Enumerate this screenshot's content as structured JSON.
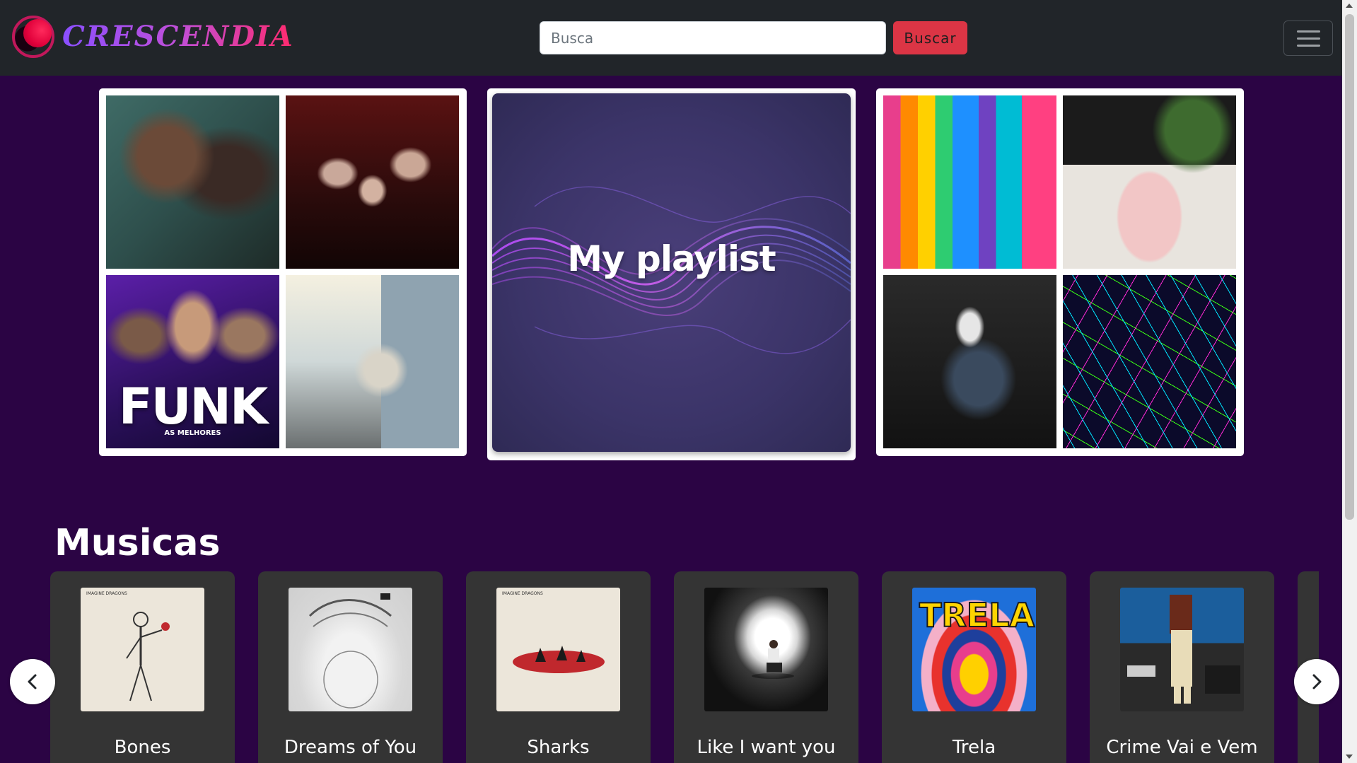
{
  "header": {
    "brand": "CRESCENDIA",
    "search": {
      "placeholder": "Busca",
      "value": ""
    },
    "search_button": "Buscar"
  },
  "featured": {
    "left_collage": {
      "tiles": [
        {
          "icon": "artist-photo-duo"
        },
        {
          "icon": "band-photo"
        },
        {
          "icon": "funk-cover",
          "label": "FUNK",
          "sublabel": "AS MELHORES"
        },
        {
          "icon": "rapper-photo"
        }
      ]
    },
    "center": {
      "title": "My playlist"
    },
    "right_collage": {
      "tiles": [
        {
          "icon": "colorful-guitars"
        },
        {
          "icon": "record-player"
        },
        {
          "icon": "guitarist-photo"
        },
        {
          "icon": "laser-lights"
        }
      ]
    }
  },
  "musicas": {
    "title": "Musicas",
    "songs": [
      {
        "title": "Bones",
        "cover": "skeleton-cover"
      },
      {
        "title": "Dreams of You",
        "cover": "sketch-portrait-cover"
      },
      {
        "title": "Sharks",
        "cover": "sharks-cover"
      },
      {
        "title": "Like I want you",
        "cover": "spotlight-cover"
      },
      {
        "title": "Trela",
        "cover": "trela-cover"
      },
      {
        "title": "Crime Vai e Vem",
        "cover": "racionais-cover"
      }
    ]
  },
  "colors": {
    "page_bg": "#2b0444",
    "navbar_bg": "#212529",
    "accent_red": "#dc3545",
    "card_bg": "#343434"
  }
}
